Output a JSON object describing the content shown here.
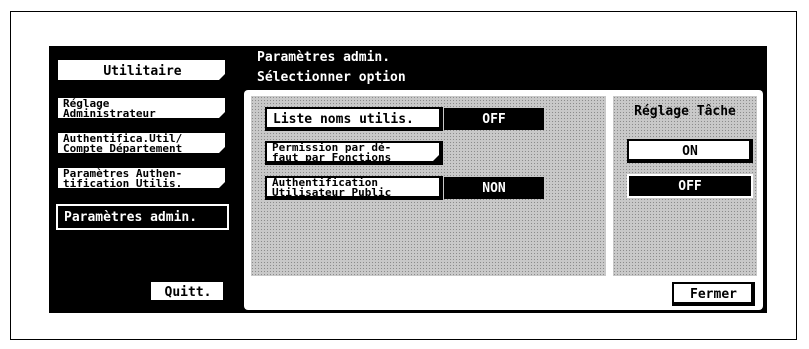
{
  "left_menu": {
    "items": [
      {
        "line1": "Utilitaire",
        "line2": ""
      },
      {
        "line1": "Réglage",
        "line2": "Administrateur"
      },
      {
        "line1": "Authentifica.Util/",
        "line2": "Compte Département"
      },
      {
        "line1": "Paramètres Authen-",
        "line2": "tification Utilis."
      },
      {
        "line1": "Paramètres admin.",
        "line2": ""
      }
    ],
    "quit_label": "Quitt."
  },
  "header": {
    "title": "Paramètres admin.",
    "subtitle": "Sélectionner option"
  },
  "options": [
    {
      "label_line1": "Liste noms utilis.",
      "label_line2": "",
      "value": "OFF"
    },
    {
      "label_line1": "Permission par dé-",
      "label_line2": "faut par Fonctions",
      "value": ""
    },
    {
      "label_line1": "Authentification",
      "label_line2": "Utilisateur Public",
      "value": "NON"
    }
  ],
  "task_panel": {
    "title": "Réglage Tâche",
    "on_label": "ON",
    "off_label": "OFF",
    "selected": "OFF"
  },
  "close_label": "Fermer"
}
